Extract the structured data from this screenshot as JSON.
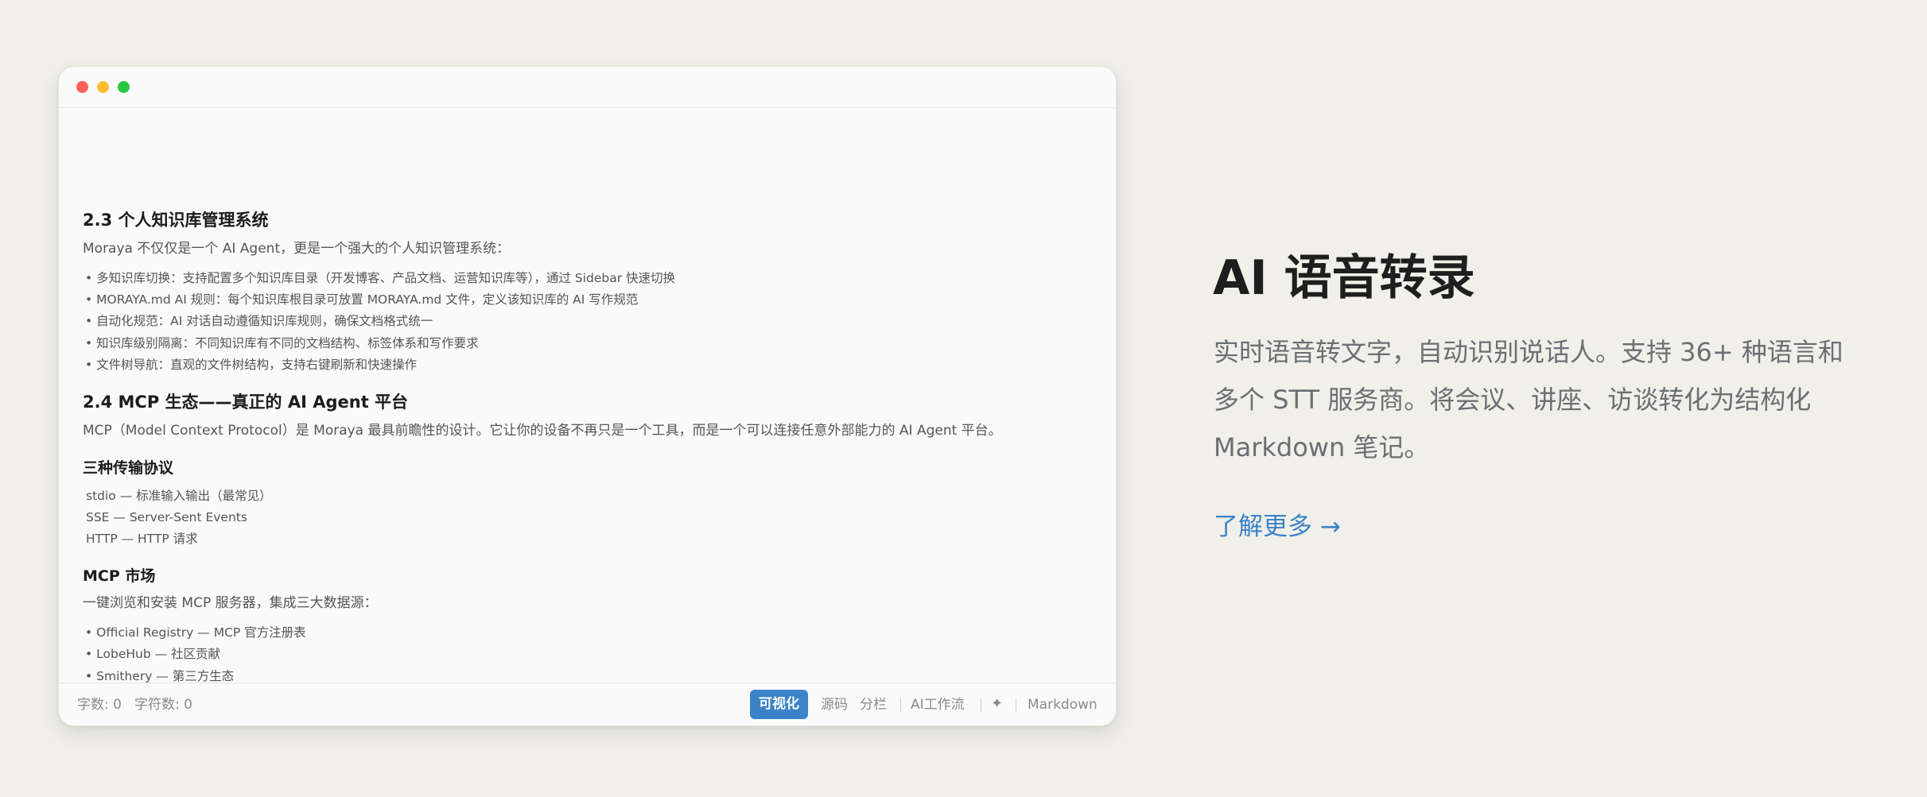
{
  "window": {
    "controls": {
      "close_color": "#ff5f57",
      "minimize_color": "#febc2e",
      "zoom_color": "#28c840"
    }
  },
  "document": {
    "section_2_3": {
      "title": "2.3 个人知识库管理系统",
      "intro": "Moraya 不仅仅是一个 AI Agent，更是一个强大的个人知识管理系统：",
      "bullets": [
        "多知识库切换：支持配置多个知识库目录（开发博客、产品文档、运营知识库等），通过 Sidebar 快速切换",
        "MORAYA.md AI 规则：每个知识库根目录可放置 MORAYA.md 文件，定义该知识库的 AI 写作规范",
        "自动化规范：AI 对话自动遵循知识库规则，确保文档格式统一",
        "知识库级别隔离：不同知识库有不同的文档结构、标签体系和写作要求",
        "文件树导航：直观的文件树结构，支持右键刷新和快速操作"
      ]
    },
    "section_2_4": {
      "title": "2.4 MCP 生态——真正的 AI Agent 平台",
      "intro": "MCP（Model Context Protocol）是 Moraya 最具前瞻性的设计。它让你的设备不再只是一个工具，而是一个可以连接任意外部能力的 AI Agent 平台。"
    },
    "transport": {
      "title": "三种传输协议",
      "items": [
        "stdio — 标准输入输出（最常见）",
        "SSE — Server-Sent Events",
        "HTTP — HTTP 请求"
      ]
    },
    "market": {
      "title": "MCP 市场",
      "intro": "一键浏览和安装 MCP 服务器，集成三大数据源：",
      "bullets": [
        "Official Registry — MCP 官方注册表",
        "LobeHub — 社区贡献",
        "Smithery — 第三方生态"
      ]
    },
    "bullet_glyph": "•"
  },
  "statusbar": {
    "word_count": "字数: 0",
    "char_count": "字符数: 0",
    "mode_visual": "可视化",
    "mode_source": "源码",
    "mode_split": "分栏",
    "ai_workflow": "AI工作流",
    "sparkle_glyph": "✦",
    "format": "Markdown",
    "active_color": "#3b82c9"
  },
  "feature": {
    "title": "AI 语音转录",
    "description_lines": [
      "实时语音转文字，自动识别说话人。支持 36+ 种语言和",
      "多个 STT 服务商。将会议、讲座、访谈转化为结构化",
      "Markdown 笔记。"
    ],
    "learn_more": "了解更多 →",
    "link_color": "#3b82c9"
  }
}
